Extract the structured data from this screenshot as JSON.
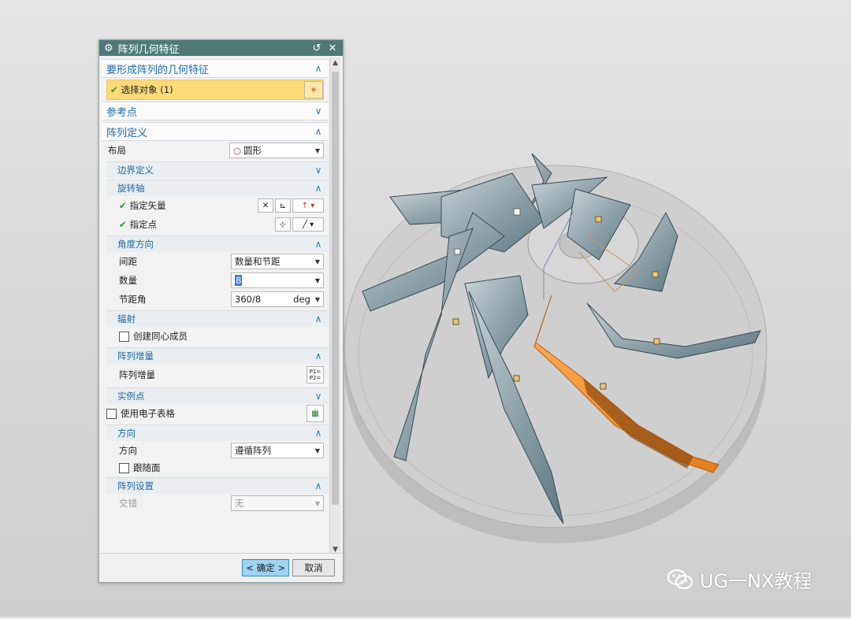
{
  "dialog": {
    "title": "阵列几何特征",
    "reset_icon": "↺",
    "close_icon": "✕"
  },
  "groups": {
    "features": {
      "label": "要形成阵列的几何特征",
      "select_label": "选择对象 (1)"
    },
    "refpoint": {
      "label": "参考点"
    },
    "pattern_def": {
      "label": "阵列定义",
      "layout_label": "布局",
      "layout_value": "圆形",
      "boundary": {
        "label": "边界定义"
      },
      "rotation_axis": {
        "label": "旋转轴",
        "vector_label": "指定矢量",
        "point_label": "指定点"
      },
      "angular": {
        "label": "角度方向",
        "spacing_label": "间距",
        "spacing_value": "数量和节距",
        "count_label": "数量",
        "count_value": "8",
        "pitch_label": "节距角",
        "pitch_value": "360/8",
        "pitch_unit": "deg"
      },
      "radial": {
        "label": "辐射",
        "concentric_label": "创建同心成员"
      },
      "increment": {
        "label": "阵列增量",
        "row_label": "阵列增量"
      },
      "instance": {
        "label": "实例点"
      },
      "spreadsheet_label": "使用电子表格",
      "orientation": {
        "label": "方向",
        "row_label": "方向",
        "value": "遵循阵列",
        "follow_face_label": "跟随面"
      },
      "settings": {
        "label": "阵列设置",
        "stagger_label": "交错",
        "stagger_value": "无"
      }
    }
  },
  "footer": {
    "ok_label": "< 确定 >",
    "cancel_label": "取消"
  },
  "watermark": {
    "text": "UG一NX教程"
  },
  "colors": {
    "titlebar": "#4f7a78",
    "header_text": "#1d6aa8",
    "selection": "#ffd97a",
    "selected_feature": "#f59a3c",
    "blade": "#8fa6b0"
  }
}
